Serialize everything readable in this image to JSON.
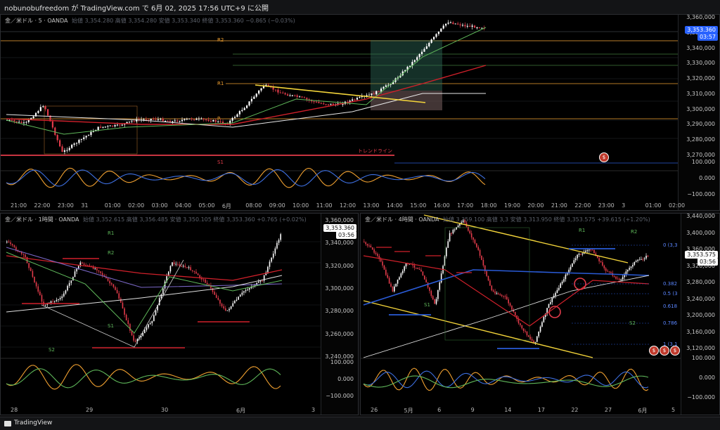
{
  "header": {
    "title": "nobunobufreedom が TradingView.com で 6月 02, 2025 17:56 UTC+9 に公開"
  },
  "footer": {
    "brand": "TradingView"
  },
  "top_chart": {
    "legend": "金／米ドル · 5 · OANDA",
    "ohlc": "始値 3,354.280 高値 3,354.280 安値 3,353.340 終値 3,353.360 −0.865 (−0.03%)",
    "price_tag": "3,353.360",
    "countdown": "03:57",
    "y_ticks": [
      "3,360,000",
      "3,350,000",
      "3,340,000",
      "3,330,000",
      "3,320,000",
      "3,310,000",
      "3,300,000",
      "3,290,000",
      "3,280,000",
      "3,270,000"
    ],
    "osc_ticks": [
      "100.000",
      "0.000",
      "−100.000"
    ],
    "x_labels": [
      "21:00",
      "22:00",
      "23:00",
      "31",
      "01:00",
      "02:00",
      "03:00",
      "04:00",
      "05:00",
      "6月",
      "08:00",
      "09:00",
      "10:00",
      "11:00",
      "12:00",
      "13:00",
      "14:00",
      "15:00",
      "16:00",
      "17:00",
      "18:00",
      "19:00",
      "20:00",
      "21:00",
      "22:00",
      "23:00",
      "3",
      "01:00",
      "02:00"
    ],
    "levels": [
      "R2",
      "R1",
      "P",
      "S1"
    ],
    "annotation": "トレンドライン"
  },
  "left_chart": {
    "legend": "金／米ドル · 1時間 · OANDA",
    "ohlc": "始値 3,352.615 高値 3,356.485 安値 3,350.105 終値 3,353.360 +0.765 (+0.02%)",
    "price_tag": "3,353.360",
    "countdown": "03:56",
    "y_ticks": [
      "3,360,000",
      "3,340,000",
      "3,320,000",
      "3,300,000",
      "3,280,000",
      "3,260,000",
      "3,240,000"
    ],
    "osc_ticks": [
      "100.000",
      "0.000",
      "−100.000"
    ],
    "x_labels": [
      "28",
      "29",
      "30",
      "6月",
      "3"
    ],
    "levels": [
      "R1",
      "R2",
      "S1",
      "S2"
    ]
  },
  "right_chart": {
    "legend": "金／米ドル · 4時間 · OANDA",
    "ohlc": "始値 3,359.100 高値 3,3 安値 3,313.950 終値 3,353.575 +39.615 (+1.20%)",
    "price_tag": "3,353.575",
    "countdown": "03:56",
    "y_ticks": [
      "3,440,000",
      "3,400,000",
      "3,360,000",
      "3,320,000",
      "3,280,000",
      "3,240,000",
      "3,200,000",
      "3,160,000",
      "3,120,000"
    ],
    "osc_ticks": [
      "100.000",
      "0.000",
      "−100.000"
    ],
    "x_labels": [
      "26",
      "5月",
      "6",
      "9",
      "14",
      "17",
      "22",
      "27",
      "6月",
      "5"
    ],
    "fib": [
      "0 (3,3",
      "0.382",
      "0.5 (3",
      "0.618",
      "0.786",
      "1 (3,1"
    ],
    "levels": [
      "R1",
      "R2",
      "S1",
      "S2"
    ]
  },
  "colors": {
    "up": "#ffffff",
    "down": "#e23b4a",
    "yellow": "#f3d43a",
    "orange": "#f0a030",
    "blue": "#2a5bd7",
    "green": "#5fb85a",
    "red": "#d0202a"
  }
}
